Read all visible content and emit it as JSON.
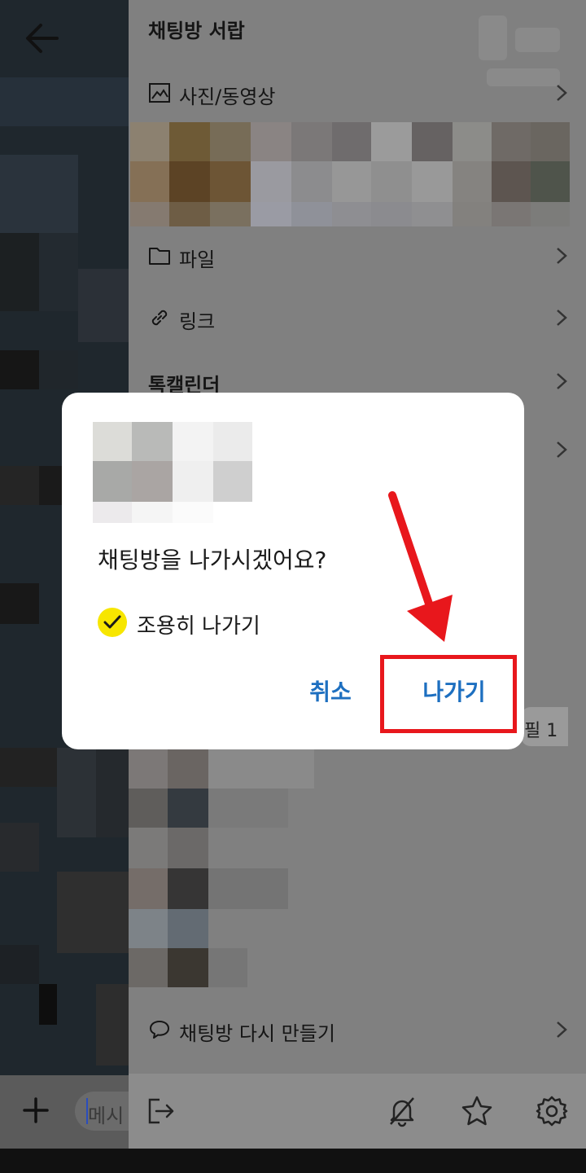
{
  "drawer": {
    "title": "채팅방 서랍",
    "rows": {
      "media": "사진/동영상",
      "file": "파일",
      "link": "링크",
      "calendar": "톡캘린더",
      "recreate": "채팅방 다시 만들기"
    },
    "profile_badge": "필 1"
  },
  "chat": {
    "input_placeholder": "메시"
  },
  "dialog": {
    "message": "채팅방을 나가시겠어요?",
    "quiet_leave_label": "조용히 나가기",
    "quiet_leave_checked": true,
    "cancel_label": "취소",
    "exit_label": "나가기"
  },
  "colors": {
    "accent_blue": "#1d6fc0",
    "check_yellow": "#f7e600",
    "annotation_red": "#e8171c",
    "dim_overlay": "#808080"
  },
  "icons": [
    "back-arrow-icon",
    "image-icon",
    "folder-icon",
    "link-icon",
    "chevron-right-icon",
    "speech-bubble-icon",
    "exit-icon",
    "bell-off-icon",
    "star-icon",
    "gear-icon",
    "plus-icon",
    "check-icon"
  ]
}
